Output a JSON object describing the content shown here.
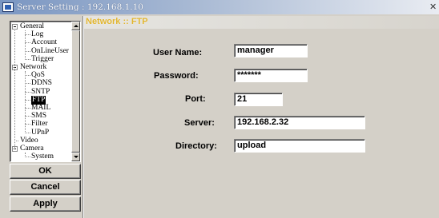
{
  "window": {
    "title": "Server Setting : 192.168.1.10",
    "close_glyph": "✕"
  },
  "tree": {
    "items": [
      {
        "label": "General",
        "level": 0,
        "expanded": true
      },
      {
        "label": "Log",
        "level": 1
      },
      {
        "label": "Account",
        "level": 1
      },
      {
        "label": "OnLineUser",
        "level": 1
      },
      {
        "label": "Trigger",
        "level": 1
      },
      {
        "label": "Network",
        "level": 0,
        "expanded": true
      },
      {
        "label": "QoS",
        "level": 1
      },
      {
        "label": "DDNS",
        "level": 1
      },
      {
        "label": "SNTP",
        "level": 1
      },
      {
        "label": "FTP",
        "level": 1,
        "selected": true
      },
      {
        "label": "MAIL",
        "level": 1
      },
      {
        "label": "SMS",
        "level": 1
      },
      {
        "label": "Filter",
        "level": 1
      },
      {
        "label": "UPnP",
        "level": 1
      },
      {
        "label": "Video",
        "level": 0
      },
      {
        "label": "Camera",
        "level": 0,
        "expanded": true
      },
      {
        "label": "System",
        "level": 1
      }
    ]
  },
  "buttons": {
    "ok": "OK",
    "cancel": "Cancel",
    "apply": "Apply"
  },
  "main": {
    "header": "Network :: FTP",
    "header_color": "#e1b52f",
    "fields": {
      "user_name": {
        "label": "User Name:",
        "value": "manager"
      },
      "password": {
        "label": "Password:",
        "value": "*******"
      },
      "port": {
        "label": "Port:",
        "value": "21"
      },
      "server": {
        "label": "Server:",
        "value": "192.168.2.32"
      },
      "directory": {
        "label": "Directory:",
        "value": "upload"
      }
    }
  },
  "colors": {
    "titlebar_start": "#7a96c2",
    "face": "#d4d0c8",
    "selection": "#000000"
  }
}
